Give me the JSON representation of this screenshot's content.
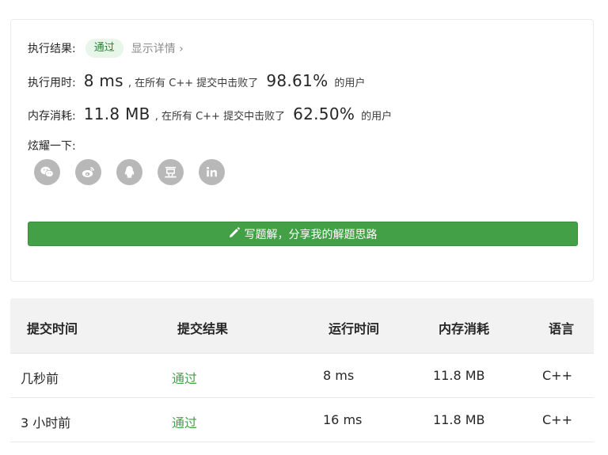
{
  "result": {
    "label": "执行结果:",
    "status": "通过",
    "detail_link": "显示详情 ›"
  },
  "runtime": {
    "label": "执行用时:",
    "value": "8 ms",
    "prefix": ", 在所有 C++ 提交中击败了",
    "percent": "98.61%",
    "suffix": "的用户"
  },
  "memory": {
    "label": "内存消耗:",
    "value": "11.8 MB",
    "prefix": ", 在所有 C++ 提交中击败了",
    "percent": "62.50%",
    "suffix": "的用户"
  },
  "share": {
    "label": "炫耀一下:",
    "icons": [
      "wechat-icon",
      "weibo-icon",
      "qq-icon",
      "douban-icon",
      "linkedin-icon"
    ]
  },
  "write_button": {
    "label": "写题解，分享我的解题思路",
    "icon": "pencil-icon",
    "color": "#43a047"
  },
  "submissions": {
    "headers": [
      "提交时间",
      "提交结果",
      "运行时间",
      "内存消耗",
      "语言"
    ],
    "rows": [
      [
        "几秒前",
        "通过",
        "8 ms",
        "11.8 MB",
        "C++"
      ],
      [
        "3 小时前",
        "通过",
        "16 ms",
        "11.8 MB",
        "C++"
      ]
    ]
  }
}
